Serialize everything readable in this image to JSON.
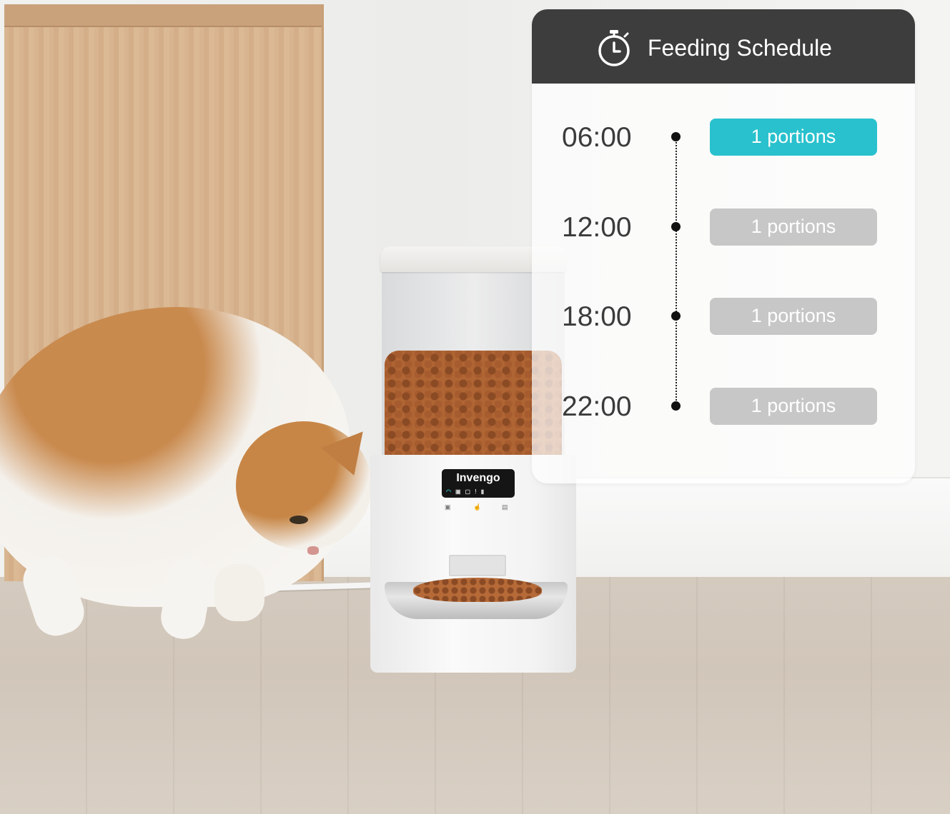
{
  "card": {
    "title": "Feeding Schedule",
    "header_color": "#3d3d3d",
    "icon": "stopwatch-icon"
  },
  "schedule": [
    {
      "time": "06:00",
      "portion": "1 portions",
      "active": true
    },
    {
      "time": "12:00",
      "portion": "1 portions",
      "active": false
    },
    {
      "time": "18:00",
      "portion": "1 portions",
      "active": false
    },
    {
      "time": "22:00",
      "portion": "1 portions",
      "active": false
    }
  ],
  "colors": {
    "active_pill": "#29c1cd",
    "idle_pill": "#c7c7c7"
  },
  "product": {
    "brand": "Invengo"
  }
}
